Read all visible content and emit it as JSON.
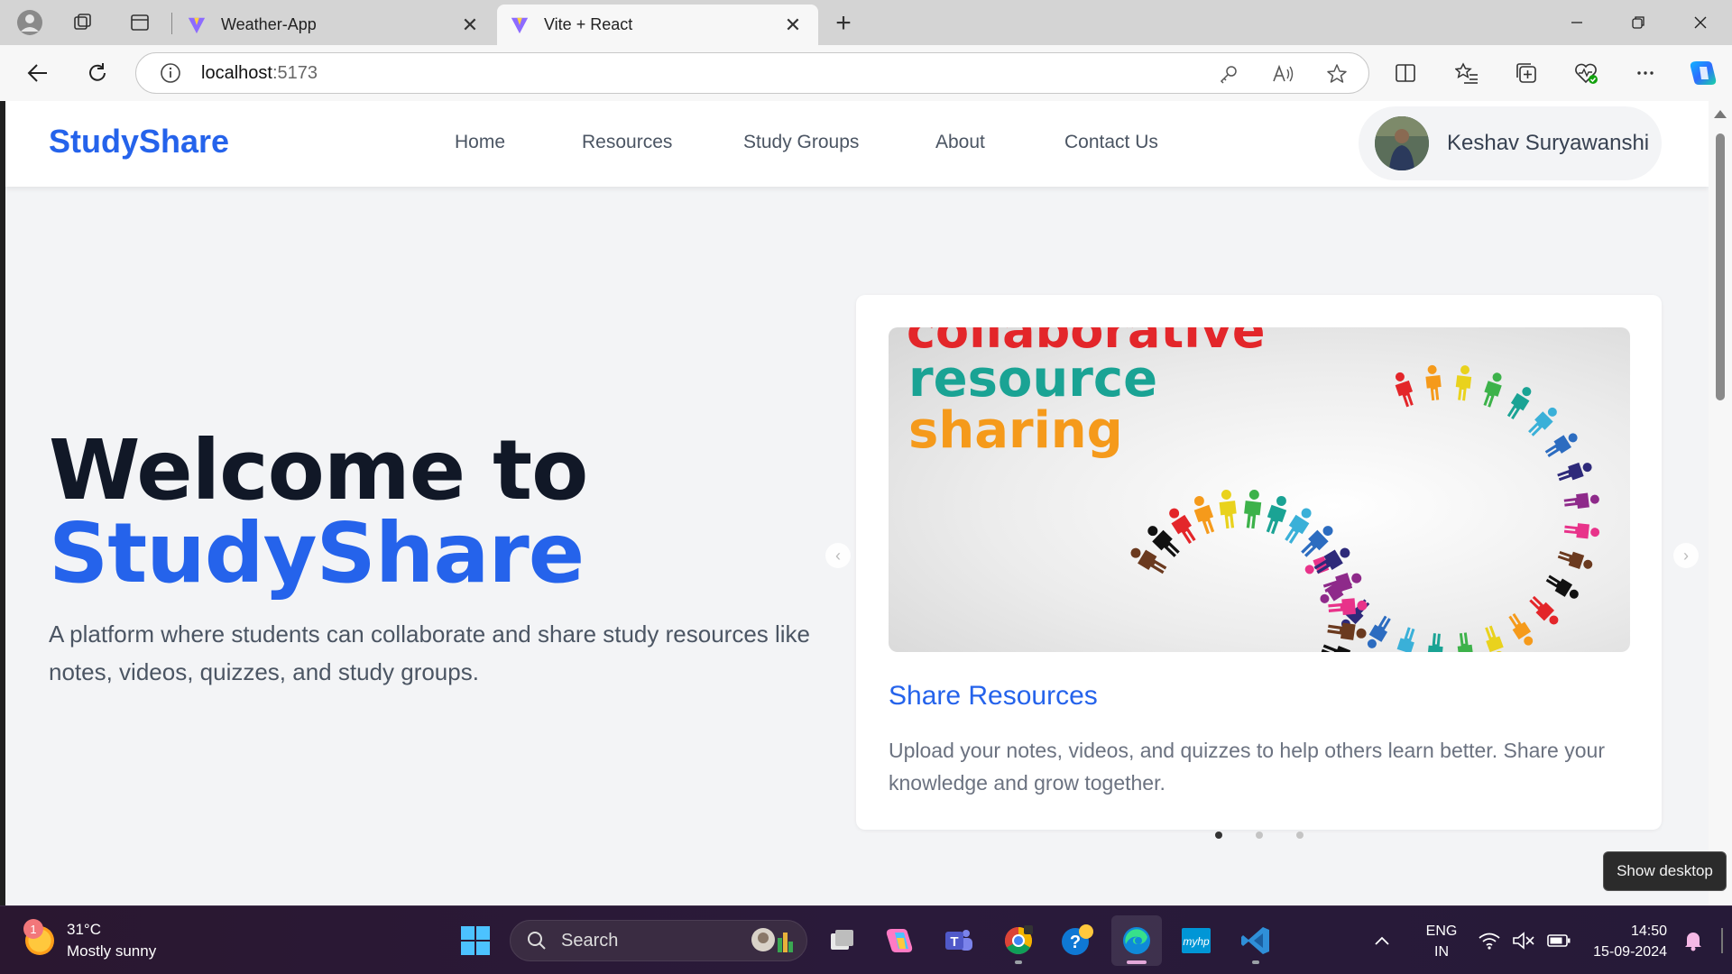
{
  "browser": {
    "tabs": [
      {
        "title": "Weather-App",
        "active": false
      },
      {
        "title": "Vite + React",
        "active": true
      }
    ],
    "url_host": "localhost",
    "url_port": ":5173"
  },
  "app": {
    "brand": "StudyShare",
    "nav": [
      "Home",
      "Resources",
      "Study Groups",
      "About",
      "Contact Us"
    ],
    "user_name": "Keshav Suryawanshi",
    "hero": {
      "title_line1": "Welcome to",
      "title_line2": "StudyShare",
      "subtitle": "A platform where students can collaborate and share study resources like notes, videos, quizzes, and study groups."
    },
    "carousel": {
      "image_text": [
        "collaborative",
        "resource",
        "sharing"
      ],
      "slide_title": "Share Resources",
      "slide_desc": "Upload your notes, videos, and quizzes to help others learn better. Share your knowledge and grow together.",
      "slide_count": 3,
      "active_index": 0
    }
  },
  "tooltip": "Show desktop",
  "taskbar": {
    "weather_temp": "31°C",
    "weather_desc": "Mostly sunny",
    "weather_badge": "1",
    "search_label": "Search",
    "lang_top": "ENG",
    "lang_bottom": "IN",
    "time": "14:50",
    "date": "15-09-2024"
  },
  "colors": {
    "accent": "#2563eb",
    "heading": "#111827",
    "body_text": "#4b5563",
    "page_bg": "#f3f4f6"
  }
}
